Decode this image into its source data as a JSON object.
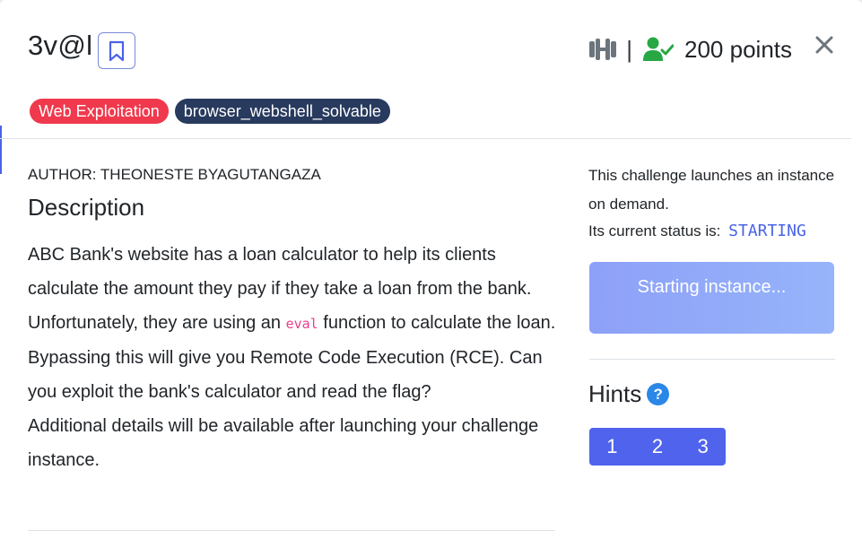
{
  "challenge": {
    "title": "3v@l",
    "points": "200 points"
  },
  "header": {
    "separator": "|"
  },
  "tags": [
    {
      "label": "Web Exploitation",
      "color": "#f0394d"
    },
    {
      "label": "browser_webshell_solvable",
      "color": "#283a5e"
    }
  ],
  "author": "AUTHOR: THEONESTE BYAGUTANGAZA",
  "description": {
    "heading": "Description",
    "text_before_code": "ABC Bank's website has a loan calculator to help its clients calculate the amount they pay if they take a loan from the bank. Unfortunately, they are using an ",
    "code": "eval",
    "text_after_code": " function to calculate the loan. Bypassing this will give you Remote Code Execution (RCE). Can you exploit the bank's calculator and read the flag?",
    "additional": "Additional details will be available after launching your challenge instance."
  },
  "instance": {
    "intro": "This challenge launches an instance on demand.",
    "status_label": "Its current status is:",
    "status_value": "STARTING",
    "button_label": "Starting instance..."
  },
  "hints": {
    "heading": "Hints",
    "help_glyph": "?",
    "items": [
      "1",
      "2",
      "3"
    ]
  },
  "icons": {
    "bookmark": "bookmark-icon",
    "difficulty": "dumbbell-icon",
    "solved": "user-check-icon",
    "close": "close-icon",
    "help": "question-circle-icon"
  },
  "colors": {
    "accent": "#4a63e8",
    "tag_red": "#f0394d",
    "tag_dark": "#283a5e",
    "solved_green": "#28a745",
    "hint_blue": "#4f63ec"
  }
}
